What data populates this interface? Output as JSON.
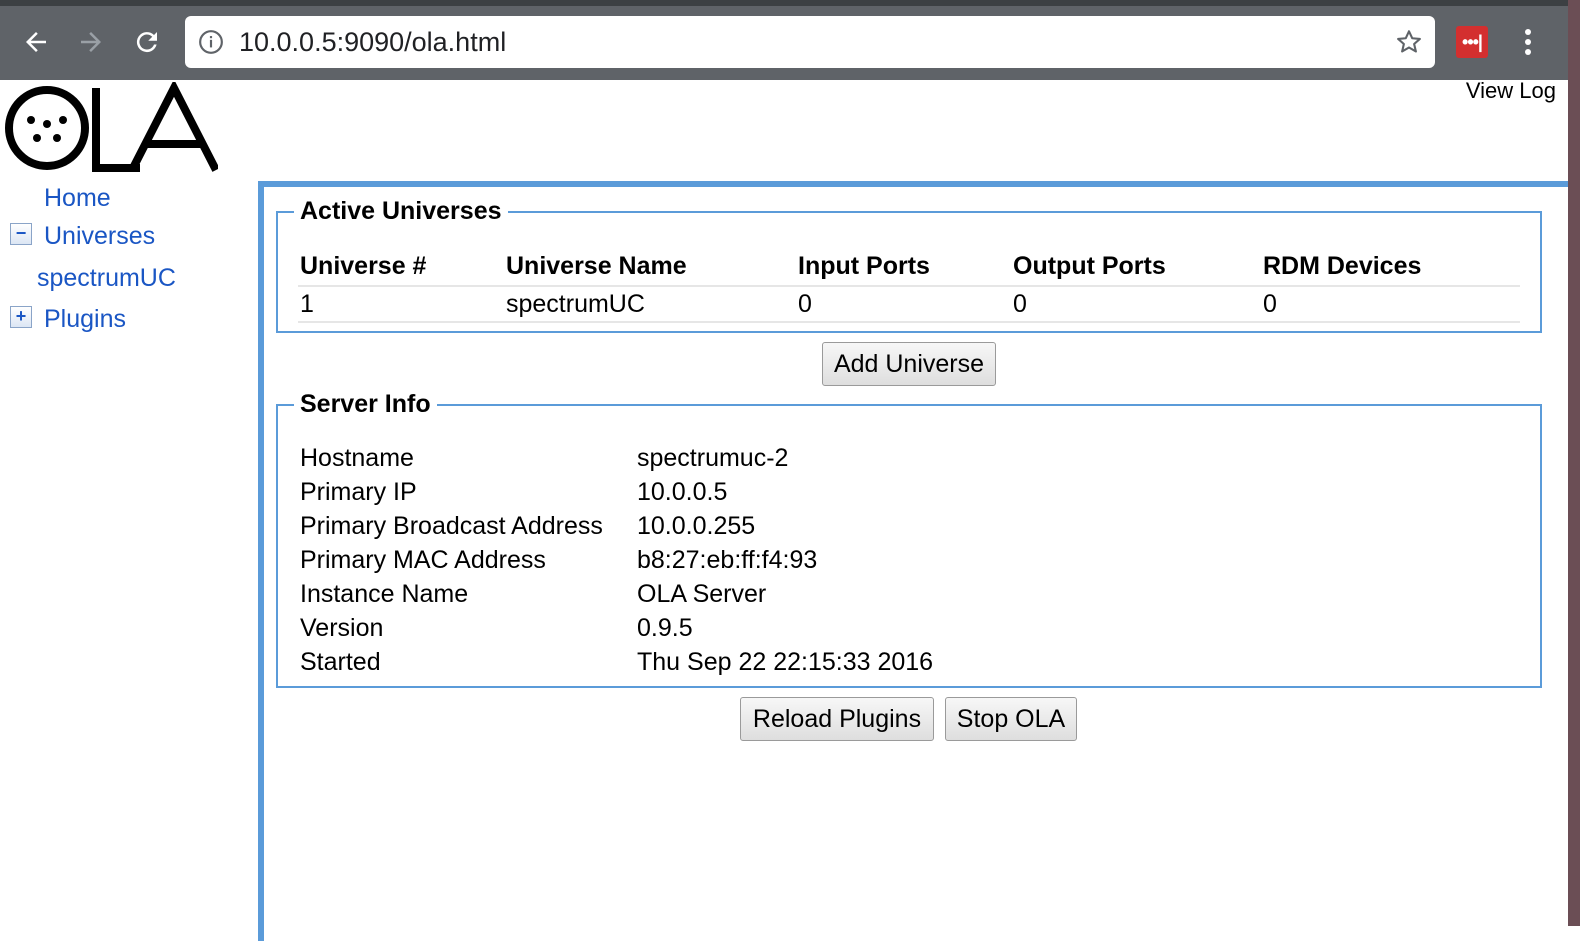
{
  "browser": {
    "url": "10.0.0.5:9090/ola.html"
  },
  "header": {
    "view_log": "View Log"
  },
  "nav": {
    "home": "Home",
    "universes": "Universes",
    "universe_items": [
      "spectrumUC"
    ],
    "plugins": "Plugins",
    "universes_toggle": "−",
    "plugins_toggle": "+"
  },
  "active_universes": {
    "legend": "Active Universes",
    "columns": [
      "Universe #",
      "Universe Name",
      "Input Ports",
      "Output Ports",
      "RDM Devices"
    ],
    "rows": [
      [
        "1",
        "spectrumUC",
        "0",
        "0",
        "0"
      ]
    ],
    "add_button": "Add Universe"
  },
  "server_info": {
    "legend": "Server Info",
    "rows": [
      {
        "key": "Hostname",
        "value": "spectrumuc-2"
      },
      {
        "key": "Primary IP",
        "value": "10.0.0.5"
      },
      {
        "key": "Primary Broadcast Address",
        "value": "10.0.0.255"
      },
      {
        "key": "Primary MAC Address",
        "value": "b8:27:eb:ff:f4:93"
      },
      {
        "key": "Instance Name",
        "value": "OLA Server"
      },
      {
        "key": "Version",
        "value": "0.9.5"
      },
      {
        "key": "Started",
        "value": "Thu Sep 22 22:15:33 2016"
      }
    ]
  },
  "actions": {
    "reload": "Reload Plugins",
    "stop": "Stop OLA"
  },
  "colors": {
    "accent": "#5b9bd9",
    "link": "#1a56c4",
    "chrome": "#5f6368"
  },
  "icons": {
    "back": "back-arrow-icon",
    "forward": "forward-arrow-icon",
    "reload": "reload-icon",
    "info": "info-icon",
    "star": "star-icon",
    "extension": "password-manager-icon",
    "menu": "kebab-menu-icon"
  }
}
